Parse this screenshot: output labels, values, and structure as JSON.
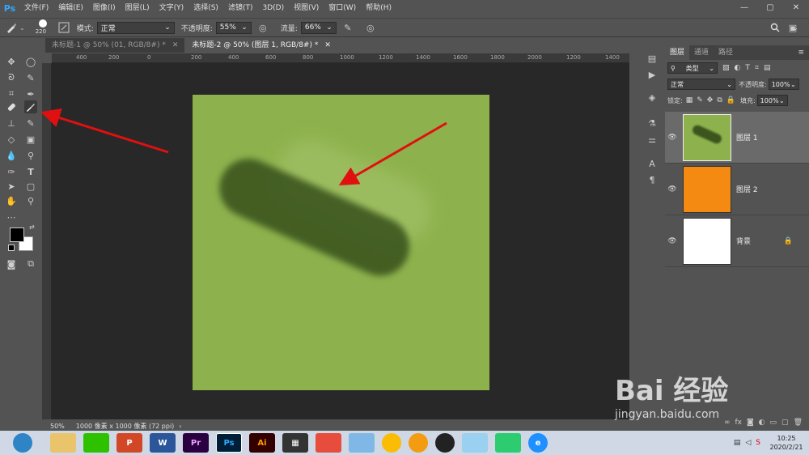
{
  "app": {
    "logo": "Ps",
    "menu": [
      "文件(F)",
      "编辑(E)",
      "图像(I)",
      "图层(L)",
      "文字(Y)",
      "选择(S)",
      "滤镜(T)",
      "3D(D)",
      "视图(V)",
      "窗口(W)",
      "帮助(H)"
    ],
    "window_controls": [
      "—",
      "▢",
      "✕"
    ]
  },
  "options": {
    "brush_size": "220",
    "mode_label": "模式:",
    "mode_value": "正常",
    "opacity_label": "不透明度:",
    "opacity_value": "55%",
    "flow_label": "流量:",
    "flow_value": "66%"
  },
  "tabs": [
    {
      "label": "未标题-1 @ 50% (01, RGB/8#) *",
      "close": "✕"
    },
    {
      "label": "未标题-2 @ 50% (图层 1, RGB/8#) *",
      "close": "✕"
    }
  ],
  "ruler": {
    "h_labels": [
      "400",
      "200",
      "0",
      "200",
      "400",
      "600",
      "800",
      "1000",
      "1200",
      "1400",
      "1600",
      "1800",
      "2000",
      "1200",
      "1400"
    ]
  },
  "status": {
    "zoom": "50%",
    "doc_info": "1000 像素 x 1000 像素 (72 ppi)"
  },
  "layers_panel": {
    "tabs": [
      "图层",
      "通道",
      "路径"
    ],
    "filter_label": "类型",
    "blend_mode": "正常",
    "opacity_label": "不透明度:",
    "opacity_value": "100%",
    "lock_label": "锁定:",
    "fill_label": "填充:",
    "fill_value": "100%",
    "layers": [
      {
        "name": "图层 1",
        "color": "#8db14c"
      },
      {
        "name": "图层 2",
        "color": "#f48a12"
      },
      {
        "name": "背景",
        "color": "#ffffff"
      }
    ]
  },
  "taskbar": {
    "time": "10:25",
    "date": "2020/2/21"
  },
  "watermark": {
    "brand": "Bai 经验",
    "url": "jingyan.baidu.com"
  },
  "colors": {
    "canvas": "#8db14c",
    "stroke": "#3c551e",
    "arrow": "#e01010",
    "ps_blue": "#31a8ff"
  }
}
